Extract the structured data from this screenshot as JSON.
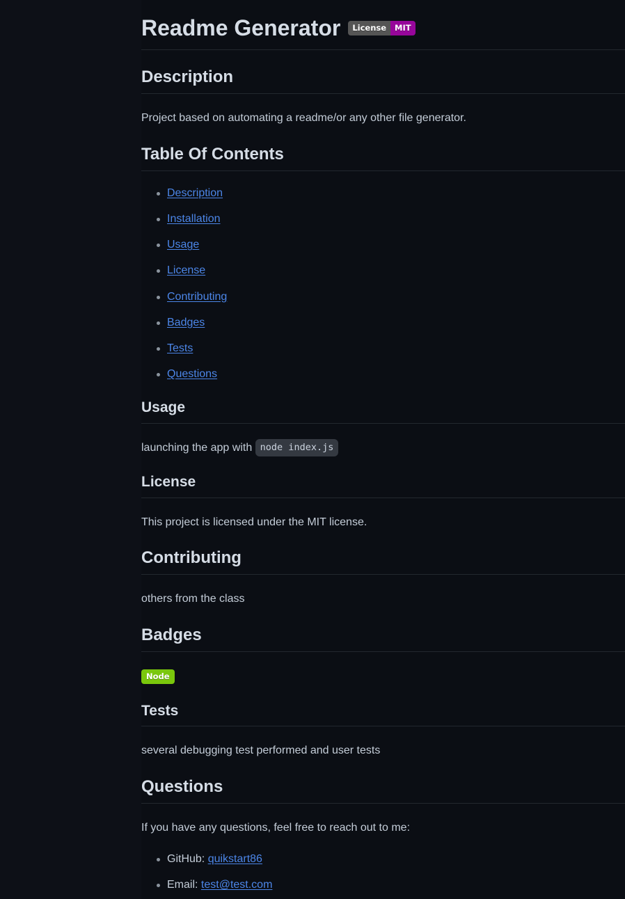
{
  "document": {
    "title": "Readme Generator",
    "license_badge": {
      "label": "License",
      "value": "MIT",
      "label_color": "#555555",
      "value_color": "#97069a"
    },
    "sections": {
      "description": {
        "heading": "Description",
        "body": "Project based on automating a readme/or any other file generator."
      },
      "table_of_contents": {
        "heading": "Table Of Contents",
        "items": [
          {
            "label": "Description"
          },
          {
            "label": "Installation"
          },
          {
            "label": "Usage"
          },
          {
            "label": "License"
          },
          {
            "label": "Contributing"
          },
          {
            "label": "Badges"
          },
          {
            "label": "Tests"
          },
          {
            "label": "Questions"
          }
        ]
      },
      "usage": {
        "heading": "Usage",
        "body_before_code": "launching the app with ",
        "code": "node index.js"
      },
      "license": {
        "heading": "License",
        "body": "This project is licensed under the MIT license."
      },
      "contributing": {
        "heading": "Contributing",
        "body": "others from the class"
      },
      "badges": {
        "heading": "Badges",
        "items": [
          {
            "label": "Node",
            "color": "#7ac70c"
          }
        ]
      },
      "tests": {
        "heading": "Tests",
        "body": "several debugging test performed and user tests"
      },
      "questions": {
        "heading": "Questions",
        "body": "If you have any questions, feel free to reach out to me:",
        "github_label": "GitHub: ",
        "github_value": "quikstart86",
        "email_label": "Email: ",
        "email_value": "test@test.com"
      }
    }
  },
  "colors": {
    "background": "#0b0e14",
    "gutter": "#0d1017",
    "text": "#c4cdd8",
    "heading": "#d6dde6",
    "link": "#4c86e8",
    "rule": "#23282f",
    "code_background": "#343941"
  }
}
